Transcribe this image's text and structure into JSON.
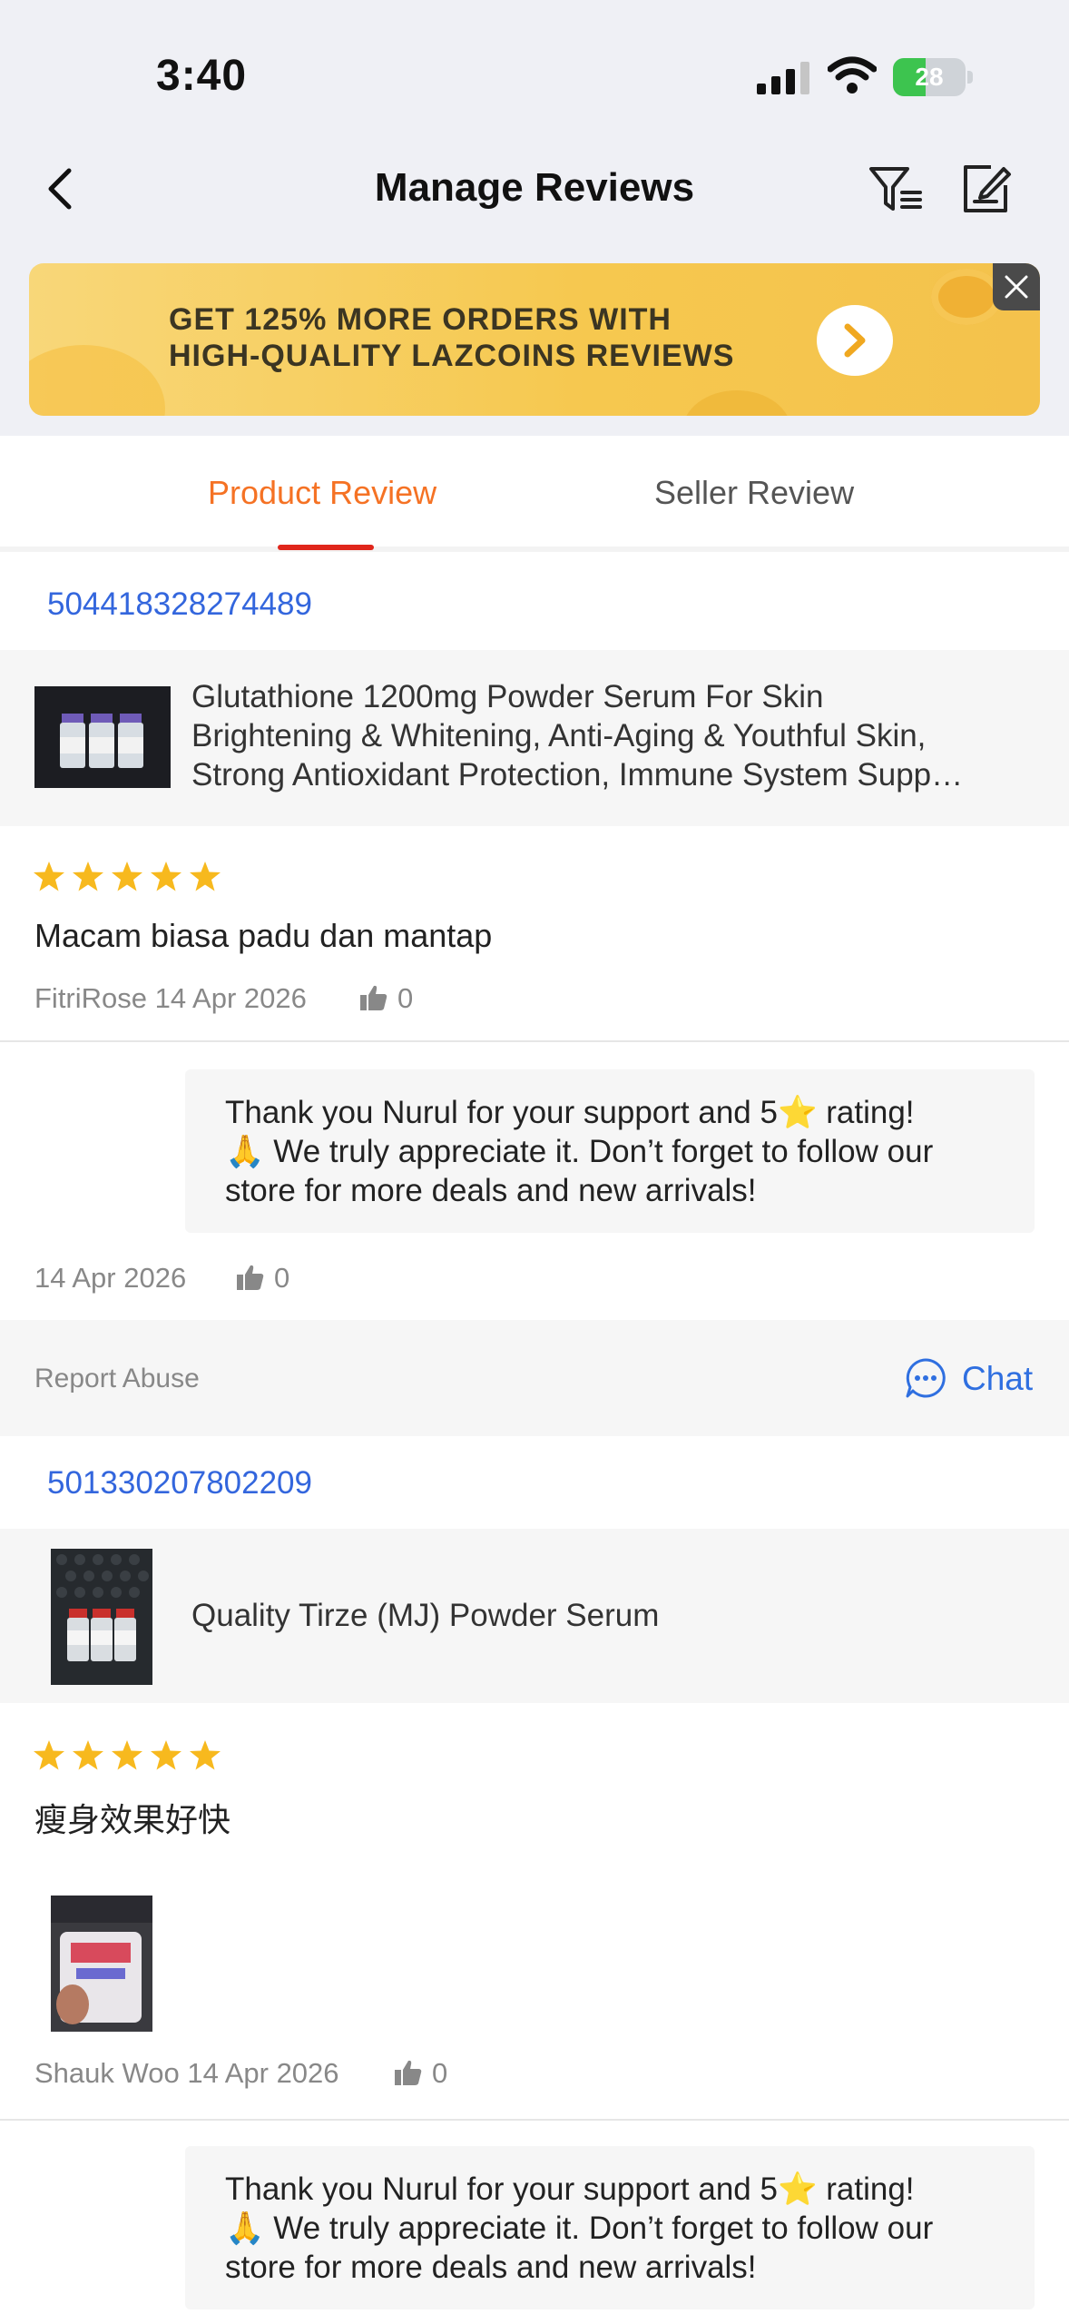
{
  "status_bar": {
    "time": "3:40",
    "battery": "28",
    "battery_level": 0.28
  },
  "header": {
    "title": "Manage Reviews"
  },
  "banner": {
    "line1": "GET 125% MORE ORDERS WITH",
    "line2": "HIGH-QUALITY LAZCOINS REVIEWS"
  },
  "tabs": [
    {
      "label": "Product Review",
      "active": true
    },
    {
      "label": "Seller Review",
      "active": false
    }
  ],
  "reviews": [
    {
      "order_id": "504418328274489",
      "product_name_lines": [
        "Glutathione 1200mg Powder Serum For Skin",
        "Brightening & Whitening, Anti-Aging & Youthful Skin,",
        "Strong Antioxidant Protection, Immune System Supp…"
      ],
      "rating": 5,
      "text": "Macam biasa padu dan mantap",
      "reviewer": "FitriRose",
      "date": "14 Apr 2026",
      "likes": "0",
      "reply": {
        "lines": [
          "Thank you Nurul for your support and 5⭐ rating!",
          "🙏 We truly appreciate it. Don’t forget to follow our",
          "store for more deals and new arrivals!"
        ],
        "date": "14 Apr 2026",
        "likes": "0"
      },
      "report_label": "Report Abuse",
      "chat_label": "Chat"
    },
    {
      "order_id": "501330207802209",
      "product_name": "Quality Tirze (MJ)  Powder Serum",
      "rating": 5,
      "text": "瘦身效果好快",
      "reviewer": "Shauk Woo",
      "date": "14 Apr 2026",
      "likes": "0",
      "reply": {
        "lines": [
          "Thank you Nurul for your support and 5⭐ rating!",
          "🙏 We truly appreciate it. Don’t forget to follow our",
          "store for more deals and new arrivals!"
        ]
      }
    }
  ],
  "colors": {
    "accent": "#f57224",
    "link": "#3366dd",
    "star": "#f7b91e",
    "tab_underline": "#e0261b"
  }
}
